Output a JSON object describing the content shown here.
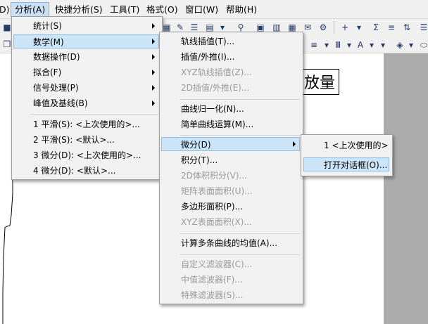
{
  "menubar": {
    "items": [
      "D)",
      "分析(A)",
      "快捷分析(S)",
      "工具(T)",
      "格式(O)",
      "窗口(W)",
      "帮助(H)"
    ]
  },
  "graph": {
    "label": "放量"
  },
  "analysis_menu": {
    "items": [
      "统计(S)",
      "数学(M)",
      "数据操作(D)",
      "拟合(F)",
      "信号处理(P)",
      "峰值及基线(B)"
    ],
    "recent": [
      "1 平滑(S): <上次使用的>...",
      "2 平滑(S): <默认>...",
      "3 微分(D): <上次使用的>...",
      "4 微分(D): <默认>..."
    ]
  },
  "math_menu": {
    "items": [
      "轨线插值(T)...",
      "插值/外推(I)...",
      "XYZ轨线插值(Z)...",
      "2D插值/外推(E)...",
      "曲线归一化(N)...",
      "简单曲线运算(M)...",
      "微分(D)",
      "积分(T)...",
      "2D体积积分(V)...",
      "矩阵表面面积(U)...",
      "多边形面积(P)...",
      "XYZ表面面积(X)...",
      "计算多条曲线的均值(A)...",
      "自定义滤波器(C)...",
      "中值滤波器(F)...",
      "特殊滤波器(S)..."
    ]
  },
  "diff_menu": {
    "items": [
      "1 <上次使用的>",
      "打开对话框(O)..."
    ]
  },
  "colors": {
    "highlight": "#cce4f8",
    "highlight_border": "#8fbde9",
    "disabled": "#9a9a9a"
  }
}
